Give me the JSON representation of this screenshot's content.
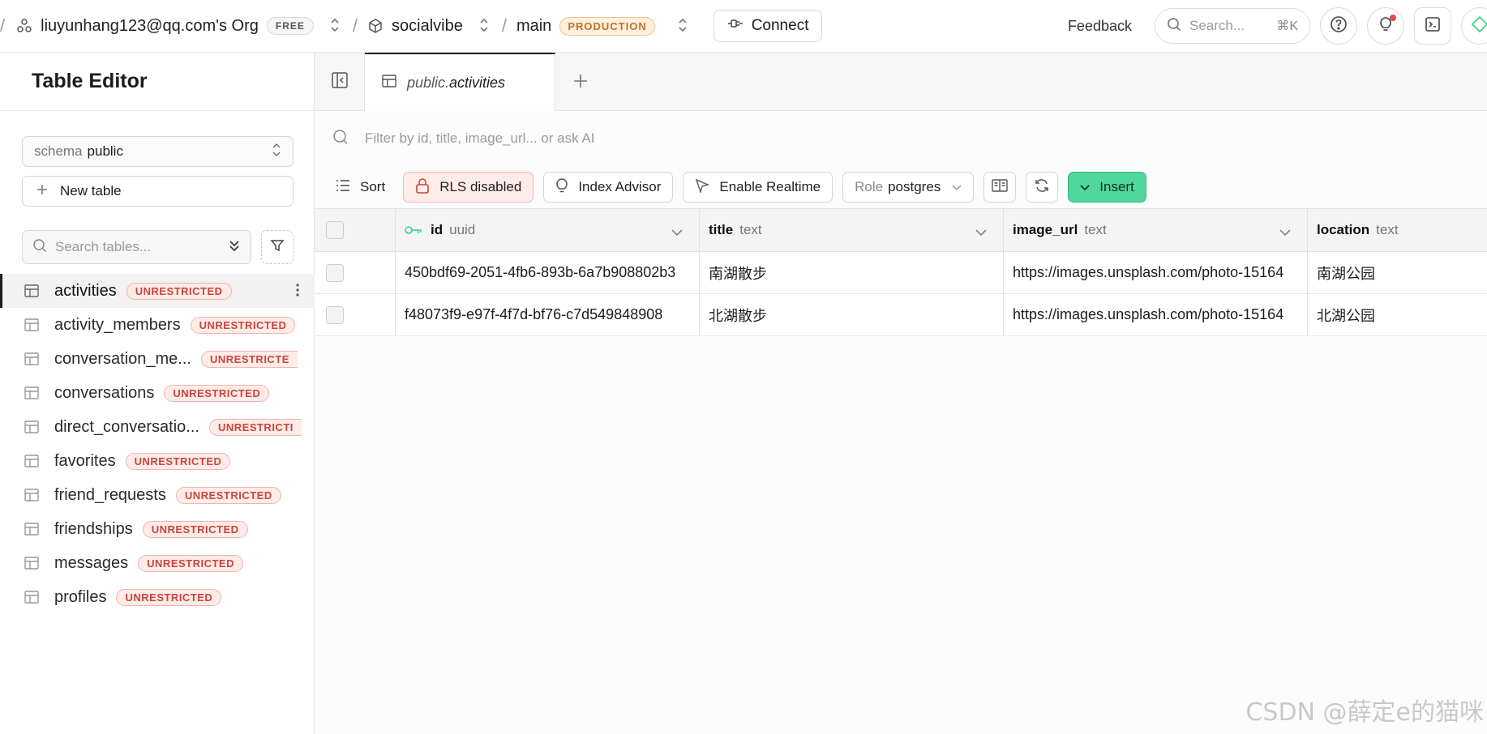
{
  "topbar": {
    "org_name": "liuyunhang123@qq.com's Org",
    "org_plan": "FREE",
    "project_name": "socialvibe",
    "branch_name": "main",
    "branch_env": "PRODUCTION",
    "connect_label": "Connect",
    "feedback_label": "Feedback",
    "search_placeholder": "Search...",
    "search_shortcut": "⌘K"
  },
  "sidebar": {
    "title": "Table Editor",
    "schema_label": "schema",
    "schema_value": "public",
    "new_table_label": "New table",
    "search_placeholder": "Search tables...",
    "tables": [
      {
        "name": "activities",
        "badge": "UNRESTRICTED",
        "active": true
      },
      {
        "name": "activity_members",
        "badge": "UNRESTRICTED"
      },
      {
        "name": "conversation_me...",
        "badge": "UNRESTRICTE"
      },
      {
        "name": "conversations",
        "badge": "UNRESTRICTED"
      },
      {
        "name": "direct_conversatio...",
        "badge": "UNRESTRICTI"
      },
      {
        "name": "favorites",
        "badge": "UNRESTRICTED"
      },
      {
        "name": "friend_requests",
        "badge": "UNRESTRICTED"
      },
      {
        "name": "friendships",
        "badge": "UNRESTRICTED"
      },
      {
        "name": "messages",
        "badge": "UNRESTRICTED"
      },
      {
        "name": "profiles",
        "badge": "UNRESTRICTED"
      }
    ]
  },
  "tabs": {
    "active_schema": "public.",
    "active_table": "activities"
  },
  "filter": {
    "placeholder": "Filter by id, title, image_url... or ask AI"
  },
  "toolbar": {
    "sort_label": "Sort",
    "rls_label": "RLS disabled",
    "index_advisor_label": "Index Advisor",
    "realtime_label": "Enable Realtime",
    "role_label": "Role",
    "role_value": "postgres",
    "insert_label": "Insert"
  },
  "grid": {
    "columns": [
      {
        "name": "id",
        "type": "uuid"
      },
      {
        "name": "title",
        "type": "text"
      },
      {
        "name": "image_url",
        "type": "text"
      },
      {
        "name": "location",
        "type": "text"
      }
    ],
    "rows": [
      [
        "450bdf69-2051-4fb6-893b-6a7b908802b3",
        "南湖散步",
        "https://images.unsplash.com/photo-15164",
        "南湖公园"
      ],
      [
        "f48073f9-e97f-4f7d-bf76-c7d549848908",
        "北湖散步",
        "https://images.unsplash.com/photo-15164",
        "北湖公园"
      ]
    ]
  },
  "watermark": "CSDN @薛定e的猫咪",
  "colors": {
    "insert_green": "#4fd79c",
    "rls_red_bg": "#fdece9",
    "badge_red": "#c9453a",
    "production_orange": "#c27321"
  }
}
